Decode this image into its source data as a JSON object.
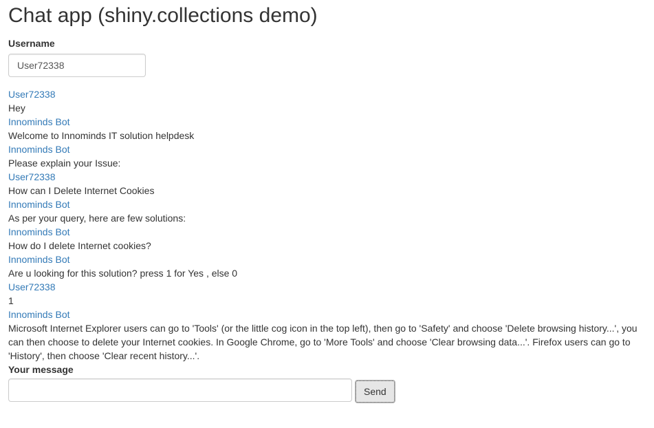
{
  "page": {
    "title": "Chat app (shiny.collections demo)"
  },
  "username_field": {
    "label": "Username",
    "value": "User72338"
  },
  "messages": [
    {
      "user": "User72338",
      "text": "Hey"
    },
    {
      "user": "Innominds Bot",
      "text": "Welcome to Innominds IT solution helpdesk"
    },
    {
      "user": "Innominds Bot",
      "text": "Please explain your Issue:"
    },
    {
      "user": "User72338",
      "text": "How can I Delete Internet Cookies"
    },
    {
      "user": "Innominds Bot",
      "text": "As per your query, here are few solutions:"
    },
    {
      "user": "Innominds Bot",
      "text": "How do I delete Internet cookies?"
    },
    {
      "user": "Innominds Bot",
      "text": "Are u looking for this solution? press 1 for Yes , else 0"
    },
    {
      "user": "User72338",
      "text": "1"
    },
    {
      "user": "Innominds Bot",
      "text": "Microsoft Internet Explorer users can go to 'Tools' (or the little cog icon in the top left), then go to 'Safety' and choose 'Delete browsing history...', you can then choose to delete your Internet cookies. In Google Chrome, go to 'More Tools' and choose 'Clear browsing data...'. Firefox users can go to 'History', then choose 'Clear recent history...'."
    }
  ],
  "message_field": {
    "label": "Your message",
    "value": ""
  },
  "send_button": {
    "label": "Send"
  },
  "colors": {
    "username_link": "#337ab7",
    "text": "#333333"
  }
}
